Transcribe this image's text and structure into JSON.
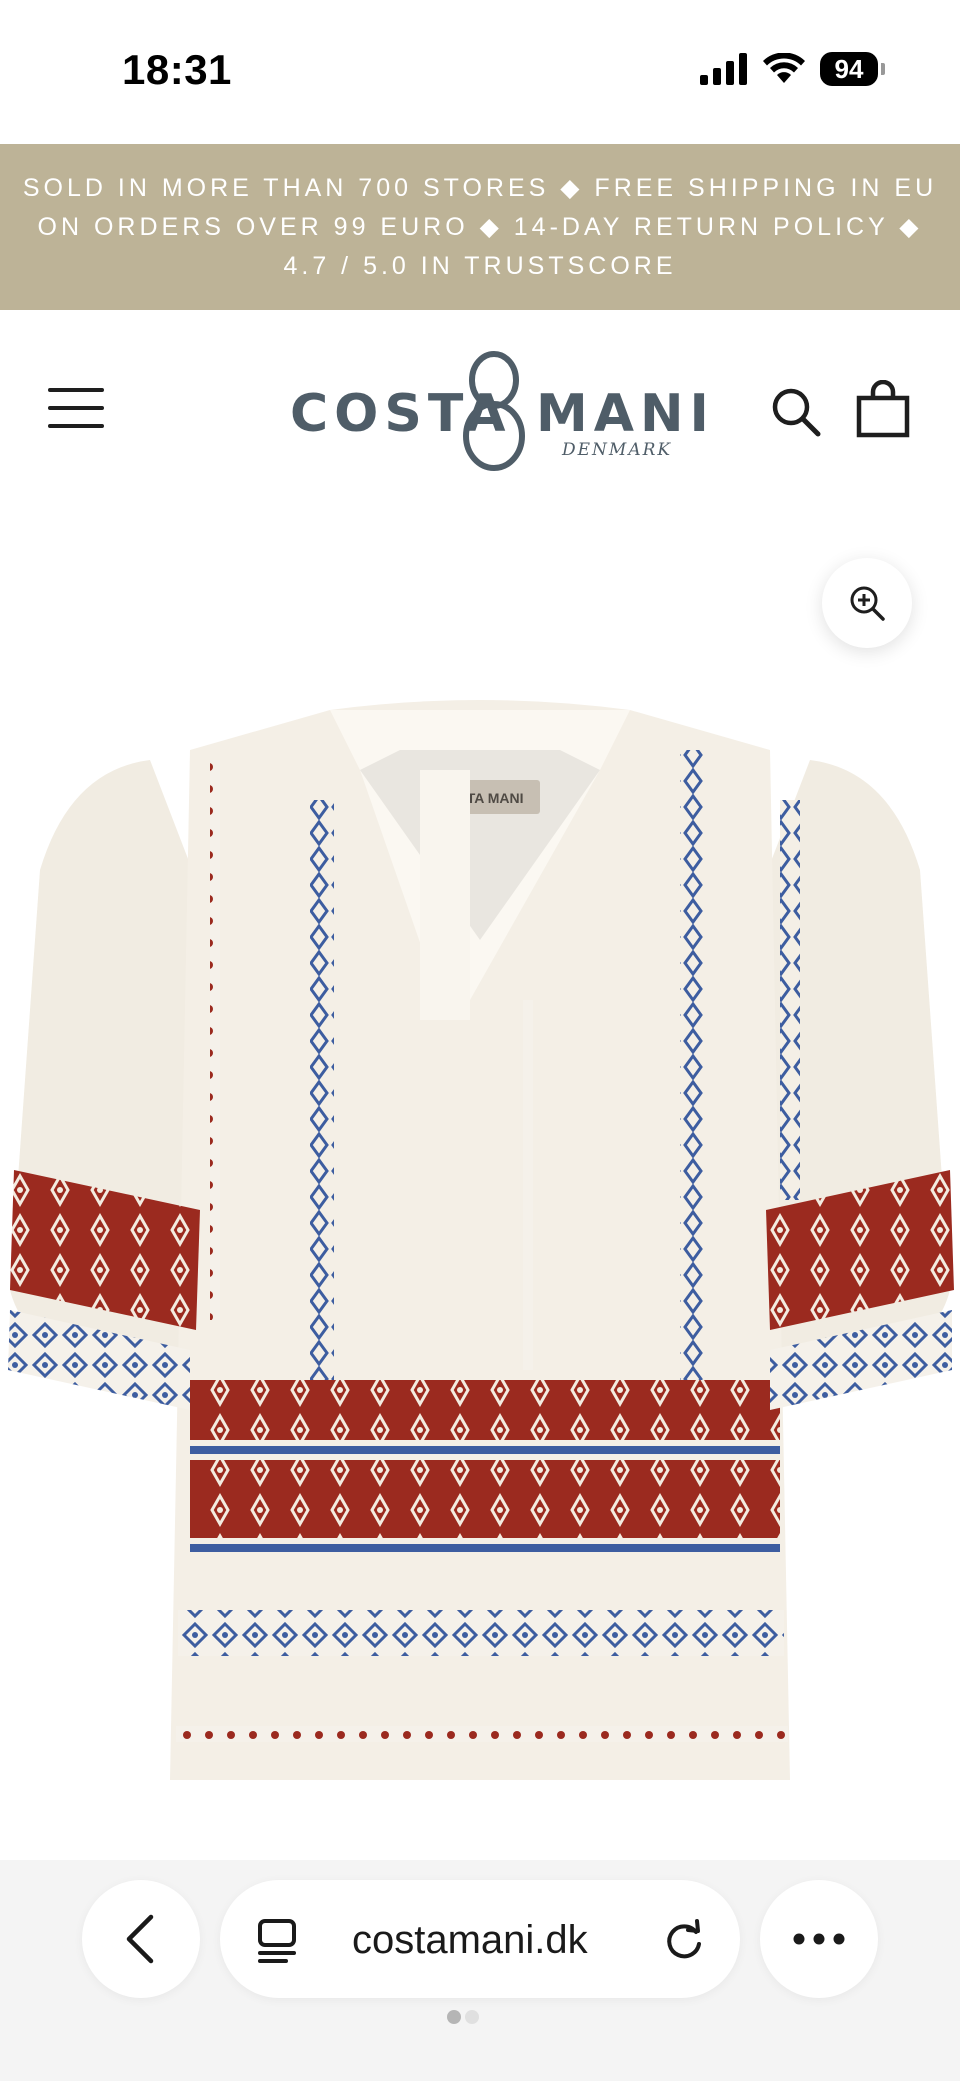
{
  "status_bar": {
    "time": "18:31",
    "battery": "94",
    "signal_icon": "cellular-signal-icon",
    "wifi_icon": "wifi-icon"
  },
  "announcement": {
    "text": "SOLD IN MORE THAN 700 STORES ◆ FREE SHIPPING IN EU ON ORDERS OVER 99 EURO ◆ 14-DAY RETURN POLICY ◆ 4.7 / 5.0 IN TRUSTSCORE",
    "background": "#bdb397"
  },
  "header": {
    "logo_left": "COSTA",
    "logo_right": "MANI",
    "logo_sub": "DENMARK",
    "menu_icon": "hamburger-menu-icon",
    "search_icon": "search-icon",
    "cart_icon": "shopping-bag-icon",
    "brand_color": "#4f5d68"
  },
  "product": {
    "zoom_icon": "zoom-in-icon",
    "image_label": "COSTA MANI"
  },
  "browser": {
    "url": "costamani.dk",
    "back_icon": "chevron-left-icon",
    "tabs_icon": "tabs-icon",
    "reload_icon": "reload-icon",
    "more_icon": "more-dots-icon",
    "page_count": 2,
    "active_page": 1
  }
}
